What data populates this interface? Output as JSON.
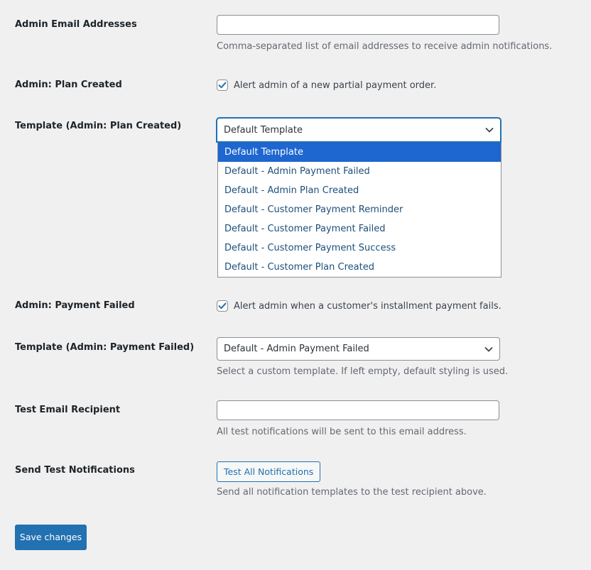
{
  "fields": {
    "admin_emails": {
      "label": "Admin Email Addresses",
      "value": "",
      "description": "Comma-separated list of email addresses to receive admin notifications."
    },
    "plan_created": {
      "label": "Admin: Plan Created",
      "checked": true,
      "checkbox_label": "Alert admin of a new partial payment order."
    },
    "template_plan_created": {
      "label": "Template (Admin: Plan Created)",
      "selected": "Default Template",
      "expanded": true,
      "options": [
        "Default Template",
        "Default - Admin Payment Failed",
        "Default - Admin Plan Created",
        "Default - Customer Payment Reminder",
        "Default - Customer Payment Failed",
        "Default - Customer Payment Success",
        "Default - Customer Plan Created"
      ]
    },
    "payment_failed": {
      "label": "Admin: Payment Failed",
      "checked": true,
      "checkbox_label": "Alert admin when a customer's installment payment fails."
    },
    "template_payment_failed": {
      "label": "Template (Admin: Payment Failed)",
      "selected": "Default - Admin Payment Failed",
      "description": "Select a custom template. If left empty, default styling is used."
    },
    "test_recipient": {
      "label": "Test Email Recipient",
      "value": "",
      "description": "All test notifications will be sent to this email address."
    },
    "send_test": {
      "label": "Send Test Notifications",
      "button_label": "Test All Notifications",
      "description": "Send all notification templates to the test recipient above."
    }
  },
  "actions": {
    "save_label": "Save changes"
  },
  "icons": {
    "checkmark": "checkmark-icon",
    "chevron": "chevron-down-icon"
  },
  "colors": {
    "accent": "#2271b1",
    "selected_option": "#1e66d0",
    "background": "#f0f0f1"
  }
}
